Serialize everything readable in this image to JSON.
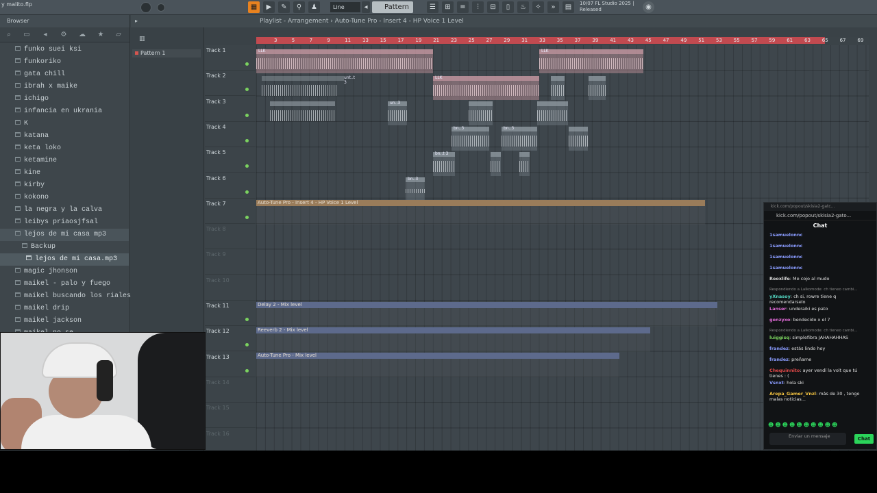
{
  "window": {
    "title": "y malito.flp"
  },
  "toolbar": {
    "line_mode": "Line",
    "pattern": "Pattern 1",
    "info_line1": "10/07  FL Studio 2025 |",
    "info_line2": "Released"
  },
  "browser": {
    "title": "Browser",
    "items": [
      {
        "label": "funko suei ksi",
        "level": 0
      },
      {
        "label": "funkoriko",
        "level": 0
      },
      {
        "label": "gata chill",
        "level": 0
      },
      {
        "label": "ibrah x maike",
        "level": 0
      },
      {
        "label": "ichigo",
        "level": 0
      },
      {
        "label": "infancia en ukrania",
        "level": 0
      },
      {
        "label": "K",
        "level": 0
      },
      {
        "label": "katana",
        "level": 0
      },
      {
        "label": "keta loko",
        "level": 0
      },
      {
        "label": "ketamine",
        "level": 0
      },
      {
        "label": "kine",
        "level": 0
      },
      {
        "label": "kirby",
        "level": 0
      },
      {
        "label": "kokono",
        "level": 0
      },
      {
        "label": "la negra y la calva",
        "level": 0
      },
      {
        "label": "leibys priaosjfsal",
        "level": 0
      },
      {
        "label": "lejos de mi casa mp3",
        "level": 0,
        "active": true
      },
      {
        "label": "Backup",
        "level": 1
      },
      {
        "label": "lejos de mi casa.mp3",
        "level": 2
      },
      {
        "label": "magic jhonson",
        "level": 0
      },
      {
        "label": "maikel - palo y fuego",
        "level": 0
      },
      {
        "label": "maikel buscando los riales",
        "level": 0
      },
      {
        "label": "maikel drip",
        "level": 0
      },
      {
        "label": "maikel jackson",
        "level": 0
      },
      {
        "label": "maikel no se",
        "level": 0
      }
    ]
  },
  "patterns": {
    "item": "Pattern 1"
  },
  "playlist": {
    "title": "Playlist - Arrangement  ›  Auto-Tune Pro - Insert 4 - HP Voice 1 Level",
    "ruler_ticks": [
      "3",
      "5",
      "7",
      "9",
      "11",
      "13",
      "15",
      "17",
      "19",
      "21",
      "23",
      "25",
      "27",
      "29",
      "31",
      "33",
      "35",
      "37",
      "39",
      "41",
      "43",
      "45",
      "47",
      "49",
      "51",
      "53",
      "55",
      "57",
      "59",
      "61",
      "63",
      "65",
      "67",
      "69"
    ],
    "tracks": [
      {
        "name": "Track 1",
        "dim": false
      },
      {
        "name": "Track 2",
        "dim": false
      },
      {
        "name": "Track 3",
        "dim": false
      },
      {
        "name": "Track 4",
        "dim": false
      },
      {
        "name": "Track 5",
        "dim": false
      },
      {
        "name": "Track 6",
        "dim": false
      },
      {
        "name": "Track 7",
        "dim": false
      },
      {
        "name": "Track 8",
        "dim": true
      },
      {
        "name": "Track 9",
        "dim": true
      },
      {
        "name": "Track 10",
        "dim": true
      },
      {
        "name": "Track 11",
        "dim": false
      },
      {
        "name": "Track 12",
        "dim": false
      },
      {
        "name": "Track 13",
        "dim": false
      },
      {
        "name": "Track 14",
        "dim": true
      },
      {
        "name": "Track 15",
        "dim": true
      },
      {
        "name": "Track 16",
        "dim": true
      }
    ],
    "clip_labels": {
      "llk": "LLK",
      "unt": "unt..t 3",
      "un": "un..3",
      "bn": "bn..3",
      "bnt": "bn..t 3"
    },
    "automation": {
      "track7": "Auto-Tune Pro - Insert 4 - HP Voice 1 Level",
      "track11": "Delay 2 - Mix level",
      "track12": "Reeverb 2 - Mix level",
      "track13": "Auto-Tune Pro - Mix level"
    }
  },
  "chat": {
    "window_title": "kick.com/popout/skisia2-gatc...",
    "url": "kick.com/popout/skisia2-gato...",
    "tab": "Chat",
    "messages": [
      {
        "user": "1samuelonnc",
        "text": "",
        "color": "#8a9cff"
      },
      {
        "user": "1samuelonnc",
        "text": "",
        "color": "#8a9cff"
      },
      {
        "user": "1samuelonnc",
        "text": "",
        "color": "#8a9cff"
      },
      {
        "user": "1samuelonnc",
        "text": "",
        "color": "#8a9cff"
      },
      {
        "user": "Reoxlife",
        "text": ": Me cojo al mudo",
        "color": "#d8d8d8"
      },
      {
        "reply": "Respondiendo a Lalkomode: ch tieneo cambi..."
      },
      {
        "user": "yXnasoy",
        "text": ": ch si, rowre tiene q recomendarselo",
        "color": "#54d9c4"
      },
      {
        "user": "Lanser",
        "text": ": underaiki es pato",
        "color": "#e16bd8"
      },
      {
        "user": "genzyxo",
        "text": ": bendecido x el 7",
        "color": "#e16bd8"
      },
      {
        "reply": "Respondiendo a Lalkomode: ch tieneo cambi..."
      },
      {
        "user": "luiggisq",
        "text": ": simplefibra JAHAHAHHAS",
        "color": "#7bd35f"
      },
      {
        "user": "frandez",
        "text": ": estás lindo hoy",
        "color": "#8a9cff"
      },
      {
        "user": "frandez",
        "text": ": preñame",
        "color": "#8a9cff"
      },
      {
        "user": "Chequinnito",
        "text": ": ayer vendí la volt que tú tienes : (",
        "color": "#e04848"
      },
      {
        "user": "Vsnxt",
        "text": ": hola ski",
        "color": "#8a9cff"
      },
      {
        "user": "Arepa_Gamer_Vnzl",
        "text": ": más de 30 , tengo malas noticias...",
        "color": "#f0c040"
      }
    ],
    "input_placeholder": "Enviar un mensaje",
    "send_label": "Chat"
  }
}
